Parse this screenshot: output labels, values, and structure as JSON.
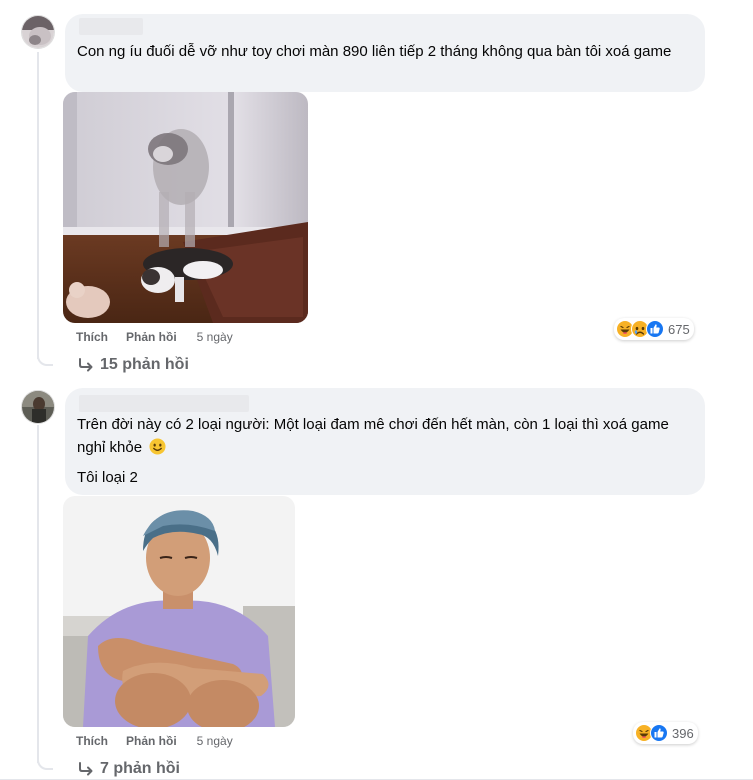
{
  "comments": [
    {
      "text_lines": [
        "Con ng íu đuối dễ vỡ như toy chơi màn 890 liên tiếp 2 tháng không qua bàn tôi xoá game"
      ],
      "actions": {
        "like": "Thích",
        "reply": "Phản hồi",
        "time": "5 ngày"
      },
      "reaction_count": "675",
      "replies_label": "15 phản hồi",
      "reactions": [
        "haha-icon",
        "sad-icon",
        "like-icon"
      ]
    },
    {
      "text_lines": [
        "Trên đời này có 2 loại người: Một loại đam mê chơi đến hết màn, còn 1 loại thì xoá game nghỉ khỏe",
        "Tôi loại 2"
      ],
      "emoji_name": "smile-emoji-icon",
      "actions": {
        "like": "Thích",
        "reply": "Phản hồi",
        "time": "5 ngày"
      },
      "reaction_count": "396",
      "replies_label": "7 phản hồi",
      "reactions": [
        "haha-icon",
        "like-icon"
      ]
    }
  ],
  "colors": {
    "bubble": "#f0f2f5",
    "secondary_text": "#65676b",
    "like_blue": "#1877f2",
    "haha_yellow": "#f7b125"
  }
}
